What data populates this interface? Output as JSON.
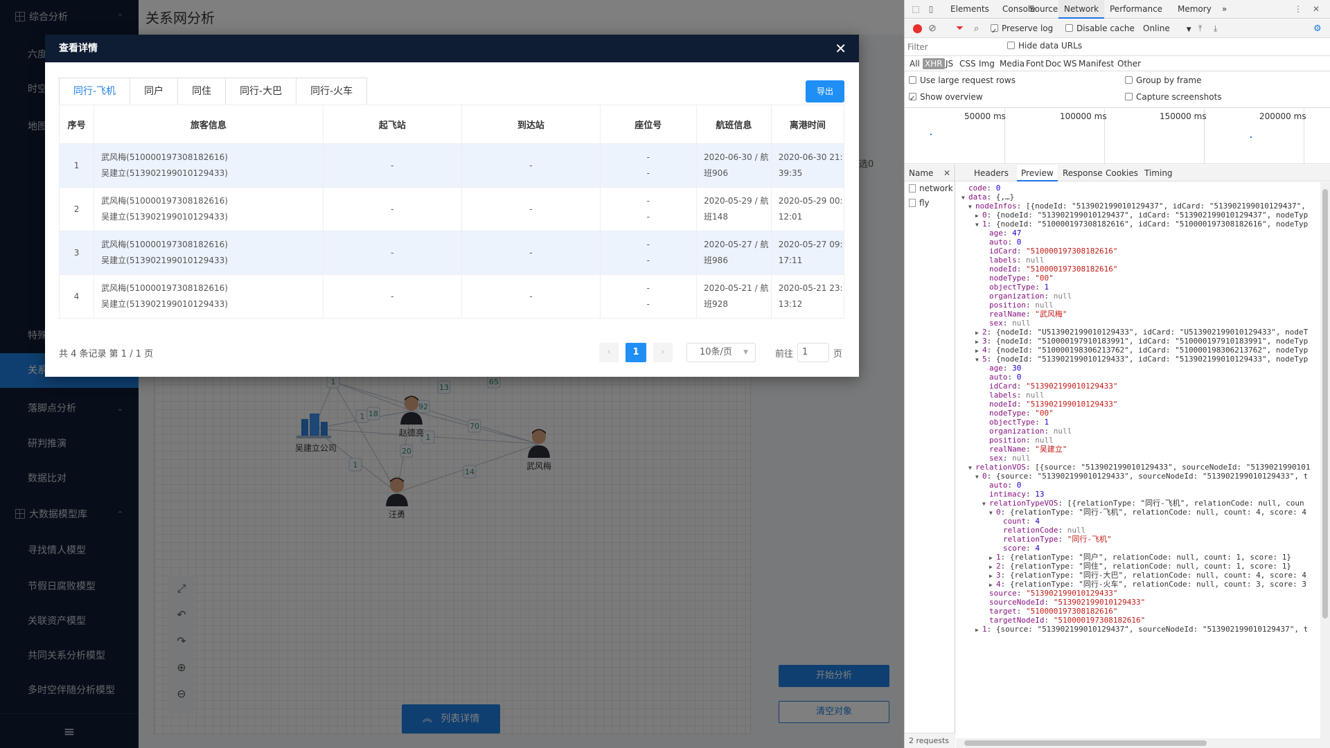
{
  "sidebar": {
    "items": [
      {
        "label": "综合分析",
        "caret": "⌃",
        "group": true
      },
      {
        "label": "六度",
        "caret": ""
      },
      {
        "label": "时空",
        "caret": ""
      },
      {
        "label": "地图",
        "caret": ""
      },
      {
        "label": "特殊",
        "caret": ""
      },
      {
        "label": "关系网分析",
        "caret": "",
        "active": true
      },
      {
        "label": "落脚点分析",
        "caret": "⌄"
      },
      {
        "label": "研判推演",
        "caret": ""
      },
      {
        "label": "数据比对",
        "caret": ""
      },
      {
        "label": "大数据模型库",
        "caret": "⌃",
        "group": true
      },
      {
        "label": "寻找情人模型",
        "caret": ""
      },
      {
        "label": "节假日腐败模型",
        "caret": ""
      },
      {
        "label": "关联资产模型",
        "caret": ""
      },
      {
        "label": "共同关系分析模型",
        "caret": ""
      },
      {
        "label": "多时空伴随分析模型",
        "caret": ""
      }
    ],
    "collapse_icon": "hamburger-icon",
    "collapse_glyph": "≡"
  },
  "header": {
    "title": "关系网分析"
  },
  "graph": {
    "nodes": [
      {
        "label": "赵德亮",
        "type": "person"
      },
      {
        "label": "吴建立公司",
        "type": "company"
      },
      {
        "label": "武风梅",
        "type": "person"
      },
      {
        "label": "汪勇",
        "type": "person"
      }
    ],
    "edge_labels": [
      "1",
      "1",
      "18",
      "13",
      "65",
      "92",
      "70",
      "1",
      "20",
      "1",
      "14"
    ]
  },
  "canvas_tools": [
    "fullscreen-icon",
    "undo-icon",
    "redo-icon",
    "zoom-in-icon",
    "zoom-out-icon"
  ],
  "canvas_tool_glyphs": [
    "⤢",
    "↶",
    "↷",
    "⊕",
    "⊖"
  ],
  "list_detail_button": "列表详情",
  "list_detail_glyph": "︽",
  "right_panel": {
    "start_button": "开始分析",
    "clear_button": "清空对象",
    "selected_text": "选0",
    "toggle_glyph": "▶"
  },
  "modal": {
    "title": "查看详情",
    "close_glyph": "✕",
    "tabs": [
      "同行-飞机",
      "同户",
      "同住",
      "同行-大巴",
      "同行-火车"
    ],
    "active_tab": 0,
    "export_button": "导出",
    "columns": [
      "序号",
      "旅客信息",
      "起飞站",
      "到达站",
      "座位号",
      "航班信息",
      "离港时间"
    ],
    "rows": [
      {
        "no": "1",
        "p1": "武风梅(510000197308182616)",
        "p2": "吴建立(513902199010129433)",
        "from": "-",
        "to": "-",
        "seat1": "-",
        "seat2": "-",
        "flight": "2020-06-30 / 航班906",
        "dept": "2020-06-30 21:39:35"
      },
      {
        "no": "2",
        "p1": "武风梅(510000197308182616)",
        "p2": "吴建立(513902199010129433)",
        "from": "-",
        "to": "-",
        "seat1": "-",
        "seat2": "-",
        "flight": "2020-05-29 / 航班148",
        "dept": "2020-05-29 00:12:01"
      },
      {
        "no": "3",
        "p1": "武风梅(510000197308182616)",
        "p2": "吴建立(513902199010129433)",
        "from": "-",
        "to": "-",
        "seat1": "-",
        "seat2": "-",
        "flight": "2020-05-27 / 航班986",
        "dept": "2020-05-27 09:17:11"
      },
      {
        "no": "4",
        "p1": "武风梅(510000197308182616)",
        "p2": "吴建立(513902199010129433)",
        "from": "-",
        "to": "-",
        "seat1": "-",
        "seat2": "-",
        "flight": "2020-05-21 / 航班928",
        "dept": "2020-05-21 23:13:12"
      }
    ],
    "pagination": {
      "summary": "共 4 条记录 第 1 / 1 页",
      "prev": "‹",
      "next": "›",
      "current": "1",
      "page_size": "10条/页",
      "goto_label": "前往",
      "goto_value": "1",
      "goto_suffix": "页"
    }
  },
  "devtools": {
    "tabs": [
      "Elements",
      "Console",
      "Sources",
      "Network",
      "Performance",
      "Memory",
      "»"
    ],
    "active_tab": "Network",
    "toolbar": {
      "preserve_log": "Preserve log",
      "preserve_log_checked": true,
      "disable_cache": "Disable cache",
      "disable_cache_checked": false,
      "throttle": "Online"
    },
    "filter_placeholder": "Filter",
    "hide_data_urls": "Hide data URLs",
    "types": [
      "All",
      "XHR",
      "JS",
      "CSS",
      "Img",
      "Media",
      "Font",
      "Doc",
      "WS",
      "Manifest",
      "Other"
    ],
    "active_type": "XHR",
    "options": {
      "large_rows": "Use large request rows",
      "group_by_frame": "Group by frame",
      "show_overview": "Show overview",
      "capture_screenshots": "Capture screenshots"
    },
    "overview_ticks": [
      "50000 ms",
      "100000 ms",
      "150000 ms",
      "200000 ms"
    ],
    "name_header": "Name",
    "requests": [
      "network",
      "fly"
    ],
    "request_count": "2 requests",
    "detail_tabs": [
      "Headers",
      "Preview",
      "Response",
      "Cookies",
      "Timing"
    ],
    "active_detail_tab": "Preview",
    "json_lines": [
      {
        "i": 1,
        "t": "",
        "k": "code",
        "v": "0",
        "vt": "n"
      },
      {
        "i": 1,
        "t": "▼",
        "k": "data",
        "v": "{,…}",
        "vt": "d"
      },
      {
        "i": 2,
        "t": "▼",
        "k": "nodeInfos",
        "v": "[{nodeId: \"513902199010129437\", idCard: \"513902199010129437\",",
        "vt": "d"
      },
      {
        "i": 3,
        "t": "▶",
        "k": "0",
        "v": "{nodeId: \"513902199010129437\", idCard: \"513902199010129437\", nodeTyp",
        "vt": "d"
      },
      {
        "i": 3,
        "t": "▼",
        "k": "1",
        "v": "{nodeId: \"510000197308182616\", idCard: \"510000197308182616\", nodeTyp",
        "vt": "d"
      },
      {
        "i": 4,
        "t": "",
        "k": "age",
        "v": "47",
        "vt": "n"
      },
      {
        "i": 4,
        "t": "",
        "k": "auto",
        "v": "0",
        "vt": "n"
      },
      {
        "i": 4,
        "t": "",
        "k": "idCard",
        "v": "\"510000197308182616\"",
        "vt": "s"
      },
      {
        "i": 4,
        "t": "",
        "k": "labels",
        "v": "null",
        "vt": "null"
      },
      {
        "i": 4,
        "t": "",
        "k": "nodeId",
        "v": "\"510000197308182616\"",
        "vt": "s"
      },
      {
        "i": 4,
        "t": "",
        "k": "nodeType",
        "v": "\"00\"",
        "vt": "s"
      },
      {
        "i": 4,
        "t": "",
        "k": "objectType",
        "v": "1",
        "vt": "n"
      },
      {
        "i": 4,
        "t": "",
        "k": "organization",
        "v": "null",
        "vt": "null"
      },
      {
        "i": 4,
        "t": "",
        "k": "position",
        "v": "null",
        "vt": "null"
      },
      {
        "i": 4,
        "t": "",
        "k": "realName",
        "v": "\"武风梅\"",
        "vt": "s"
      },
      {
        "i": 4,
        "t": "",
        "k": "sex",
        "v": "null",
        "vt": "null"
      },
      {
        "i": 3,
        "t": "▶",
        "k": "2",
        "v": "{nodeId: \"U513902199010129433\", idCard: \"U513902199010129433\", nodeT",
        "vt": "d"
      },
      {
        "i": 3,
        "t": "▶",
        "k": "3",
        "v": "{nodeId: \"510000197910183991\", idCard: \"510000197910183991\", nodeTyp",
        "vt": "d"
      },
      {
        "i": 3,
        "t": "▶",
        "k": "4",
        "v": "{nodeId: \"510000198306213762\", idCard: \"510000198306213762\", nodeTyp",
        "vt": "d"
      },
      {
        "i": 3,
        "t": "▼",
        "k": "5",
        "v": "{nodeId: \"513902199010129433\", idCard: \"513902199010129433\", nodeTyp",
        "vt": "d"
      },
      {
        "i": 4,
        "t": "",
        "k": "age",
        "v": "30",
        "vt": "n"
      },
      {
        "i": 4,
        "t": "",
        "k": "auto",
        "v": "0",
        "vt": "n"
      },
      {
        "i": 4,
        "t": "",
        "k": "idCard",
        "v": "\"513902199010129433\"",
        "vt": "s"
      },
      {
        "i": 4,
        "t": "",
        "k": "labels",
        "v": "null",
        "vt": "null"
      },
      {
        "i": 4,
        "t": "",
        "k": "nodeId",
        "v": "\"513902199010129433\"",
        "vt": "s"
      },
      {
        "i": 4,
        "t": "",
        "k": "nodeType",
        "v": "\"00\"",
        "vt": "s"
      },
      {
        "i": 4,
        "t": "",
        "k": "objectType",
        "v": "1",
        "vt": "n"
      },
      {
        "i": 4,
        "t": "",
        "k": "organization",
        "v": "null",
        "vt": "null"
      },
      {
        "i": 4,
        "t": "",
        "k": "position",
        "v": "null",
        "vt": "null"
      },
      {
        "i": 4,
        "t": "",
        "k": "realName",
        "v": "\"吴建立\"",
        "vt": "s"
      },
      {
        "i": 4,
        "t": "",
        "k": "sex",
        "v": "null",
        "vt": "null"
      },
      {
        "i": 2,
        "t": "▼",
        "k": "relationVOS",
        "v": "[{source: \"513902199010129433\", sourceNodeId: \"5139021990101",
        "vt": "d"
      },
      {
        "i": 3,
        "t": "▼",
        "k": "0",
        "v": "{source: \"513902199010129433\", sourceNodeId: \"513902199010129433\", t",
        "vt": "d"
      },
      {
        "i": 4,
        "t": "",
        "k": "auto",
        "v": "0",
        "vt": "n"
      },
      {
        "i": 4,
        "t": "",
        "k": "intimacy",
        "v": "13",
        "vt": "n"
      },
      {
        "i": 4,
        "t": "▼",
        "k": "relationTypeVOS",
        "v": "[{relationType: \"同行-飞机\", relationCode: null, coun",
        "vt": "d"
      },
      {
        "i": 5,
        "t": "▼",
        "k": "0",
        "v": "{relationType: \"同行-飞机\", relationCode: null, count: 4, score: 4",
        "vt": "d"
      },
      {
        "i": 6,
        "t": "",
        "k": "count",
        "v": "4",
        "vt": "n"
      },
      {
        "i": 6,
        "t": "",
        "k": "relationCode",
        "v": "null",
        "vt": "null"
      },
      {
        "i": 6,
        "t": "",
        "k": "relationType",
        "v": "\"同行-飞机\"",
        "vt": "s"
      },
      {
        "i": 6,
        "t": "",
        "k": "score",
        "v": "4",
        "vt": "n"
      },
      {
        "i": 5,
        "t": "▶",
        "k": "1",
        "v": "{relationType: \"同户\", relationCode: null, count: 1, score: 1}",
        "vt": "d"
      },
      {
        "i": 5,
        "t": "▶",
        "k": "2",
        "v": "{relationType: \"同住\", relationCode: null, count: 1, score: 1}",
        "vt": "d"
      },
      {
        "i": 5,
        "t": "▶",
        "k": "3",
        "v": "{relationType: \"同行-大巴\", relationCode: null, count: 4, score: 4",
        "vt": "d"
      },
      {
        "i": 5,
        "t": "▶",
        "k": "4",
        "v": "{relationType: \"同行-火车\", relationCode: null, count: 3, score: 3",
        "vt": "d"
      },
      {
        "i": 4,
        "t": "",
        "k": "source",
        "v": "\"513902199010129433\"",
        "vt": "s"
      },
      {
        "i": 4,
        "t": "",
        "k": "sourceNodeId",
        "v": "\"513902199010129433\"",
        "vt": "s"
      },
      {
        "i": 4,
        "t": "",
        "k": "target",
        "v": "\"510000197308182616\"",
        "vt": "s"
      },
      {
        "i": 4,
        "t": "",
        "k": "targetNodeId",
        "v": "\"510000197308182616\"",
        "vt": "s"
      },
      {
        "i": 3,
        "t": "▶",
        "k": "1",
        "v": "{source: \"513902199010129437\", sourceNodeId: \"513902199010129437\", t",
        "vt": "d"
      }
    ]
  }
}
